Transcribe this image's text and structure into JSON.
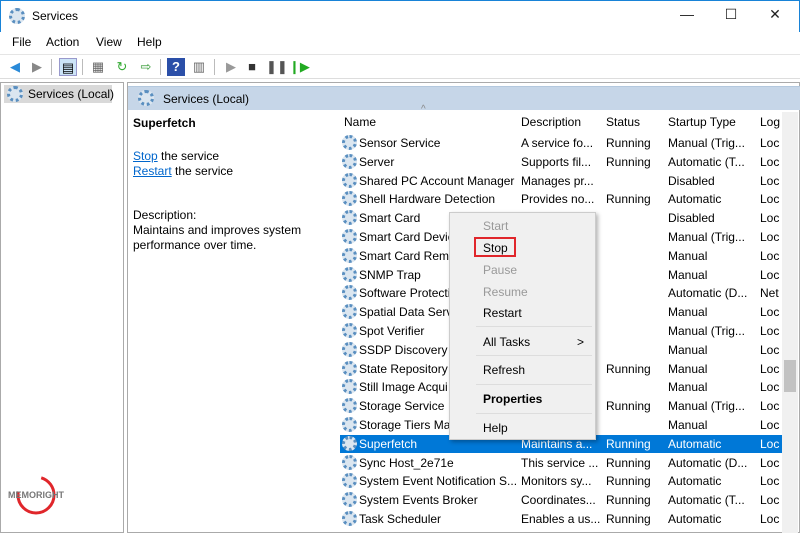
{
  "window": {
    "title": "Services",
    "minimize": "—",
    "maximize": "☐",
    "close": "✕"
  },
  "menubar": [
    "File",
    "Action",
    "View",
    "Help"
  ],
  "toolbar": {
    "icons": [
      "back-arrow",
      "forward-arrow",
      "show-hide-console-tree",
      "properties",
      "refresh",
      "export-list",
      "help",
      "show-action-pane",
      "start-service",
      "stop-service",
      "pause-service",
      "resume-service"
    ]
  },
  "tree": {
    "item": "Services (Local)"
  },
  "pane_header": "Services (Local)",
  "details": {
    "name": "Superfetch",
    "stop_link": "Stop",
    "stop_rest": " the service",
    "restart_link": "Restart",
    "restart_rest": " the service",
    "desc_label": "Description:",
    "desc_text": "Maintains and improves system performance over time."
  },
  "columns": {
    "name": "Name",
    "description": "Description",
    "status": "Status",
    "startup": "Startup Type",
    "logon": "Log"
  },
  "rows": [
    {
      "name": "Sensor Service",
      "description": "A service fo...",
      "status": "Running",
      "startup": "Manual (Trig...",
      "logon": "Loc"
    },
    {
      "name": "Server",
      "description": "Supports fil...",
      "status": "Running",
      "startup": "Automatic (T...",
      "logon": "Loc"
    },
    {
      "name": "Shared PC Account Manager",
      "description": "Manages pr...",
      "status": "",
      "startup": "Disabled",
      "logon": "Loc"
    },
    {
      "name": "Shell Hardware Detection",
      "description": "Provides no...",
      "status": "Running",
      "startup": "Automatic",
      "logon": "Loc"
    },
    {
      "name": "Smart Card",
      "description": "",
      "status": "",
      "startup": "Disabled",
      "logon": "Loc"
    },
    {
      "name": "Smart Card Devic",
      "description": "",
      "status": "",
      "startup": "Manual (Trig...",
      "logon": "Loc"
    },
    {
      "name": "Smart Card Remo",
      "description": "",
      "status": "",
      "startup": "Manual",
      "logon": "Loc"
    },
    {
      "name": "SNMP Trap",
      "description": "",
      "status": "",
      "startup": "Manual",
      "logon": "Loc"
    },
    {
      "name": "Software Protecti",
      "description": "",
      "status": "",
      "startup": "Automatic (D...",
      "logon": "Net"
    },
    {
      "name": "Spatial Data Servi",
      "description": "",
      "status": "",
      "startup": "Manual",
      "logon": "Loc"
    },
    {
      "name": "Spot Verifier",
      "description": "",
      "status": "",
      "startup": "Manual (Trig...",
      "logon": "Loc"
    },
    {
      "name": "SSDP Discovery",
      "description": "",
      "status": "",
      "startup": "Manual",
      "logon": "Loc"
    },
    {
      "name": "State Repository S",
      "description": "",
      "status": "Running",
      "startup": "Manual",
      "logon": "Loc"
    },
    {
      "name": "Still Image Acqui",
      "description": "",
      "status": "",
      "startup": "Manual",
      "logon": "Loc"
    },
    {
      "name": "Storage Service",
      "description": "",
      "status": "Running",
      "startup": "Manual (Trig...",
      "logon": "Loc"
    },
    {
      "name": "Storage Tiers Mar",
      "description": "",
      "status": "",
      "startup": "Manual",
      "logon": "Loc"
    },
    {
      "name": "Superfetch",
      "description": "Maintains a...",
      "status": "Running",
      "startup": "Automatic",
      "logon": "Loc",
      "selected": true
    },
    {
      "name": "Sync Host_2e71e",
      "description": "This service ...",
      "status": "Running",
      "startup": "Automatic (D...",
      "logon": "Loc"
    },
    {
      "name": "System Event Notification S...",
      "description": "Monitors sy...",
      "status": "Running",
      "startup": "Automatic",
      "logon": "Loc"
    },
    {
      "name": "System Events Broker",
      "description": "Coordinates...",
      "status": "Running",
      "startup": "Automatic (T...",
      "logon": "Loc"
    },
    {
      "name": "Task Scheduler",
      "description": "Enables a us...",
      "status": "Running",
      "startup": "Automatic",
      "logon": "Loc"
    }
  ],
  "context_menu": {
    "start": "Start",
    "stop": "Stop",
    "pause": "Pause",
    "resume": "Resume",
    "restart": "Restart",
    "all_tasks": "All Tasks",
    "submenu_arrow": ">",
    "refresh": "Refresh",
    "properties": "Properties",
    "help": "Help",
    "highlight_color": "#e0262b"
  },
  "logo": {
    "text": "MEMORIGHT"
  }
}
